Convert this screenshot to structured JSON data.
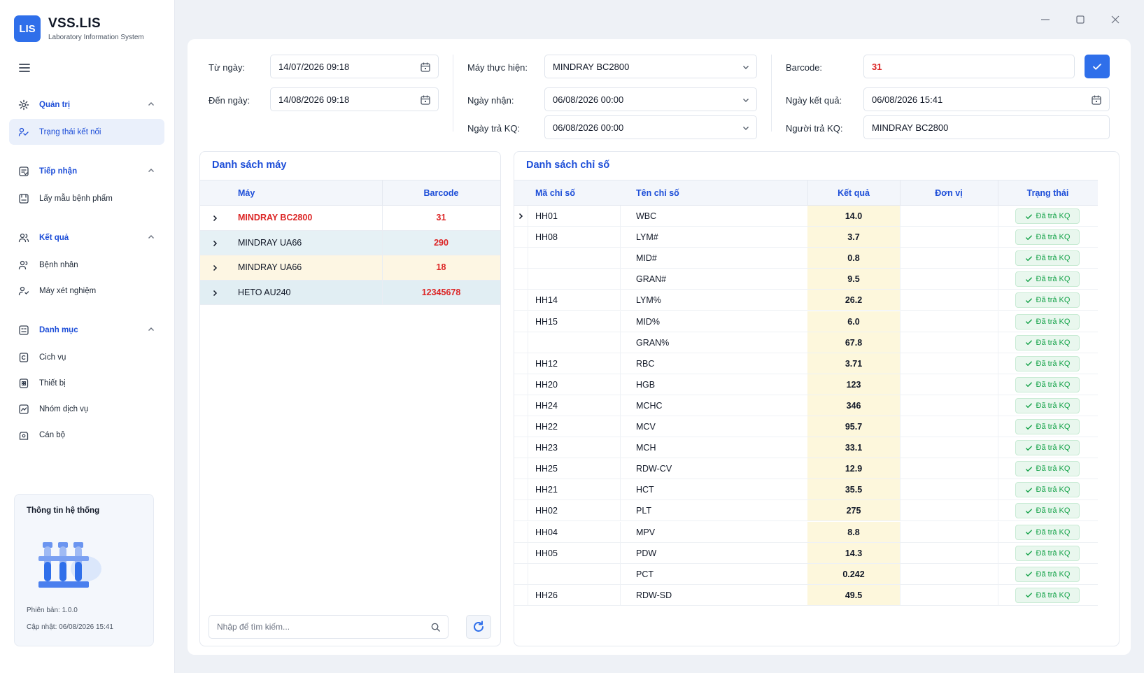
{
  "app": {
    "logo": "LIS",
    "title": "VSS.LIS",
    "subtitle": "Laboratory Information System"
  },
  "sidebar": {
    "groups": [
      {
        "label": "Quản trị",
        "icon": "gear-icon",
        "items": [
          {
            "label": "Trạng thái kết nối",
            "icon": "connection-icon",
            "active": true
          }
        ]
      },
      {
        "label": "Tiếp nhận",
        "icon": "clipboard-icon",
        "items": [
          {
            "label": "Lấy mẫu bệnh phẩm",
            "icon": "sample-icon"
          }
        ]
      },
      {
        "label": "Kết quả",
        "icon": "users-icon",
        "items": [
          {
            "label": "Bệnh nhân",
            "icon": "patient-icon"
          },
          {
            "label": "Máy xét nghiệm",
            "icon": "machine-icon"
          }
        ]
      },
      {
        "label": "Danh mục",
        "icon": "catalog-icon",
        "items": [
          {
            "label": "Cich vụ",
            "icon": "service-icon"
          },
          {
            "label": "Thiết bị",
            "icon": "device-icon"
          },
          {
            "label": "Nhóm dịch vụ",
            "icon": "service-group-icon"
          },
          {
            "label": "Cán bộ",
            "icon": "staff-icon"
          }
        ]
      }
    ]
  },
  "sysinfo": {
    "title": "Thông tin hệ thống",
    "version": "Phiên bản: 1.0.0",
    "updated": "Cập nhật: 06/08/2026 15:41"
  },
  "filters": {
    "from_label": "Từ ngày:",
    "from_value": "14/07/2026 09:18",
    "to_label": "Đến ngày:",
    "to_value": "14/08/2026 09:18",
    "machine_label": "Máy thực hiện:",
    "machine_value": "MINDRAY BC2800",
    "received_label": "Ngày nhận:",
    "received_value": "06/08/2026 00:00",
    "returned_label": "Ngày trả KQ:",
    "returned_value": "06/08/2026 00:00",
    "barcode_label": "Barcode:",
    "barcode_value": "31",
    "result_date_label": "Ngày kết quả:",
    "result_date_value": "06/08/2026 15:41",
    "returner_label": "Người trả KQ:",
    "returner_value": "MINDRAY BC2800"
  },
  "machines": {
    "title": "Danh sách máy",
    "columns": [
      "Máy",
      "Barcode"
    ],
    "rows": [
      {
        "name": "MINDRAY BC2800",
        "barcode": "31",
        "bg": "#ffffff",
        "name_color": "#dc2626"
      },
      {
        "name": "MINDRAY UA66",
        "barcode": "290",
        "bg": "#e6f1f5",
        "name_color": "#111827"
      },
      {
        "name": "MINDRAY UA66",
        "barcode": "18",
        "bg": "#fdf6e3",
        "name_color": "#111827"
      },
      {
        "name": "HETO AU240",
        "barcode": "12345678",
        "bg": "#e1eef3",
        "name_color": "#111827"
      }
    ],
    "search_placeholder": "Nhập để tìm kiếm..."
  },
  "indices": {
    "title": "Danh sách chỉ số",
    "columns": [
      "Mã chỉ số",
      "Tên chỉ số",
      "Kết quả",
      "Đơn vị",
      "Trạng thái"
    ],
    "status_label": "Đã trả KQ",
    "rows": [
      {
        "code": "HH01",
        "name": "WBC",
        "result": "14.0",
        "unit": ""
      },
      {
        "code": "HH08",
        "name": "LYM#",
        "result": "3.7",
        "unit": ""
      },
      {
        "code": "",
        "name": "MID#",
        "result": "0.8",
        "unit": ""
      },
      {
        "code": "",
        "name": "GRAN#",
        "result": "9.5",
        "unit": ""
      },
      {
        "code": "HH14",
        "name": "LYM%",
        "result": "26.2",
        "unit": ""
      },
      {
        "code": "HH15",
        "name": "MID%",
        "result": "6.0",
        "unit": ""
      },
      {
        "code": "",
        "name": "GRAN%",
        "result": "67.8",
        "unit": ""
      },
      {
        "code": "HH12",
        "name": "RBC",
        "result": "3.71",
        "unit": ""
      },
      {
        "code": "HH20",
        "name": "HGB",
        "result": "123",
        "unit": ""
      },
      {
        "code": "HH24",
        "name": "MCHC",
        "result": "346",
        "unit": ""
      },
      {
        "code": "HH22",
        "name": "MCV",
        "result": "95.7",
        "unit": ""
      },
      {
        "code": "HH23",
        "name": "MCH",
        "result": "33.1",
        "unit": ""
      },
      {
        "code": "HH25",
        "name": "RDW-CV",
        "result": "12.9",
        "unit": ""
      },
      {
        "code": "HH21",
        "name": "HCT",
        "result": "35.5",
        "unit": ""
      },
      {
        "code": "HH02",
        "name": "PLT",
        "result": "275",
        "unit": ""
      },
      {
        "code": "HH04",
        "name": "MPV",
        "result": "8.8",
        "unit": ""
      },
      {
        "code": "HH05",
        "name": "PDW",
        "result": "14.3",
        "unit": ""
      },
      {
        "code": "",
        "name": "PCT",
        "result": "0.242",
        "unit": ""
      },
      {
        "code": "HH26",
        "name": "RDW-SD",
        "result": "49.5",
        "unit": ""
      }
    ]
  },
  "colors": {
    "accent": "#2f6fea",
    "title_blue": "#1d4ed8",
    "red": "#dc2626",
    "result_bg": "#fdf7dc",
    "status_green": "#16a34a"
  }
}
